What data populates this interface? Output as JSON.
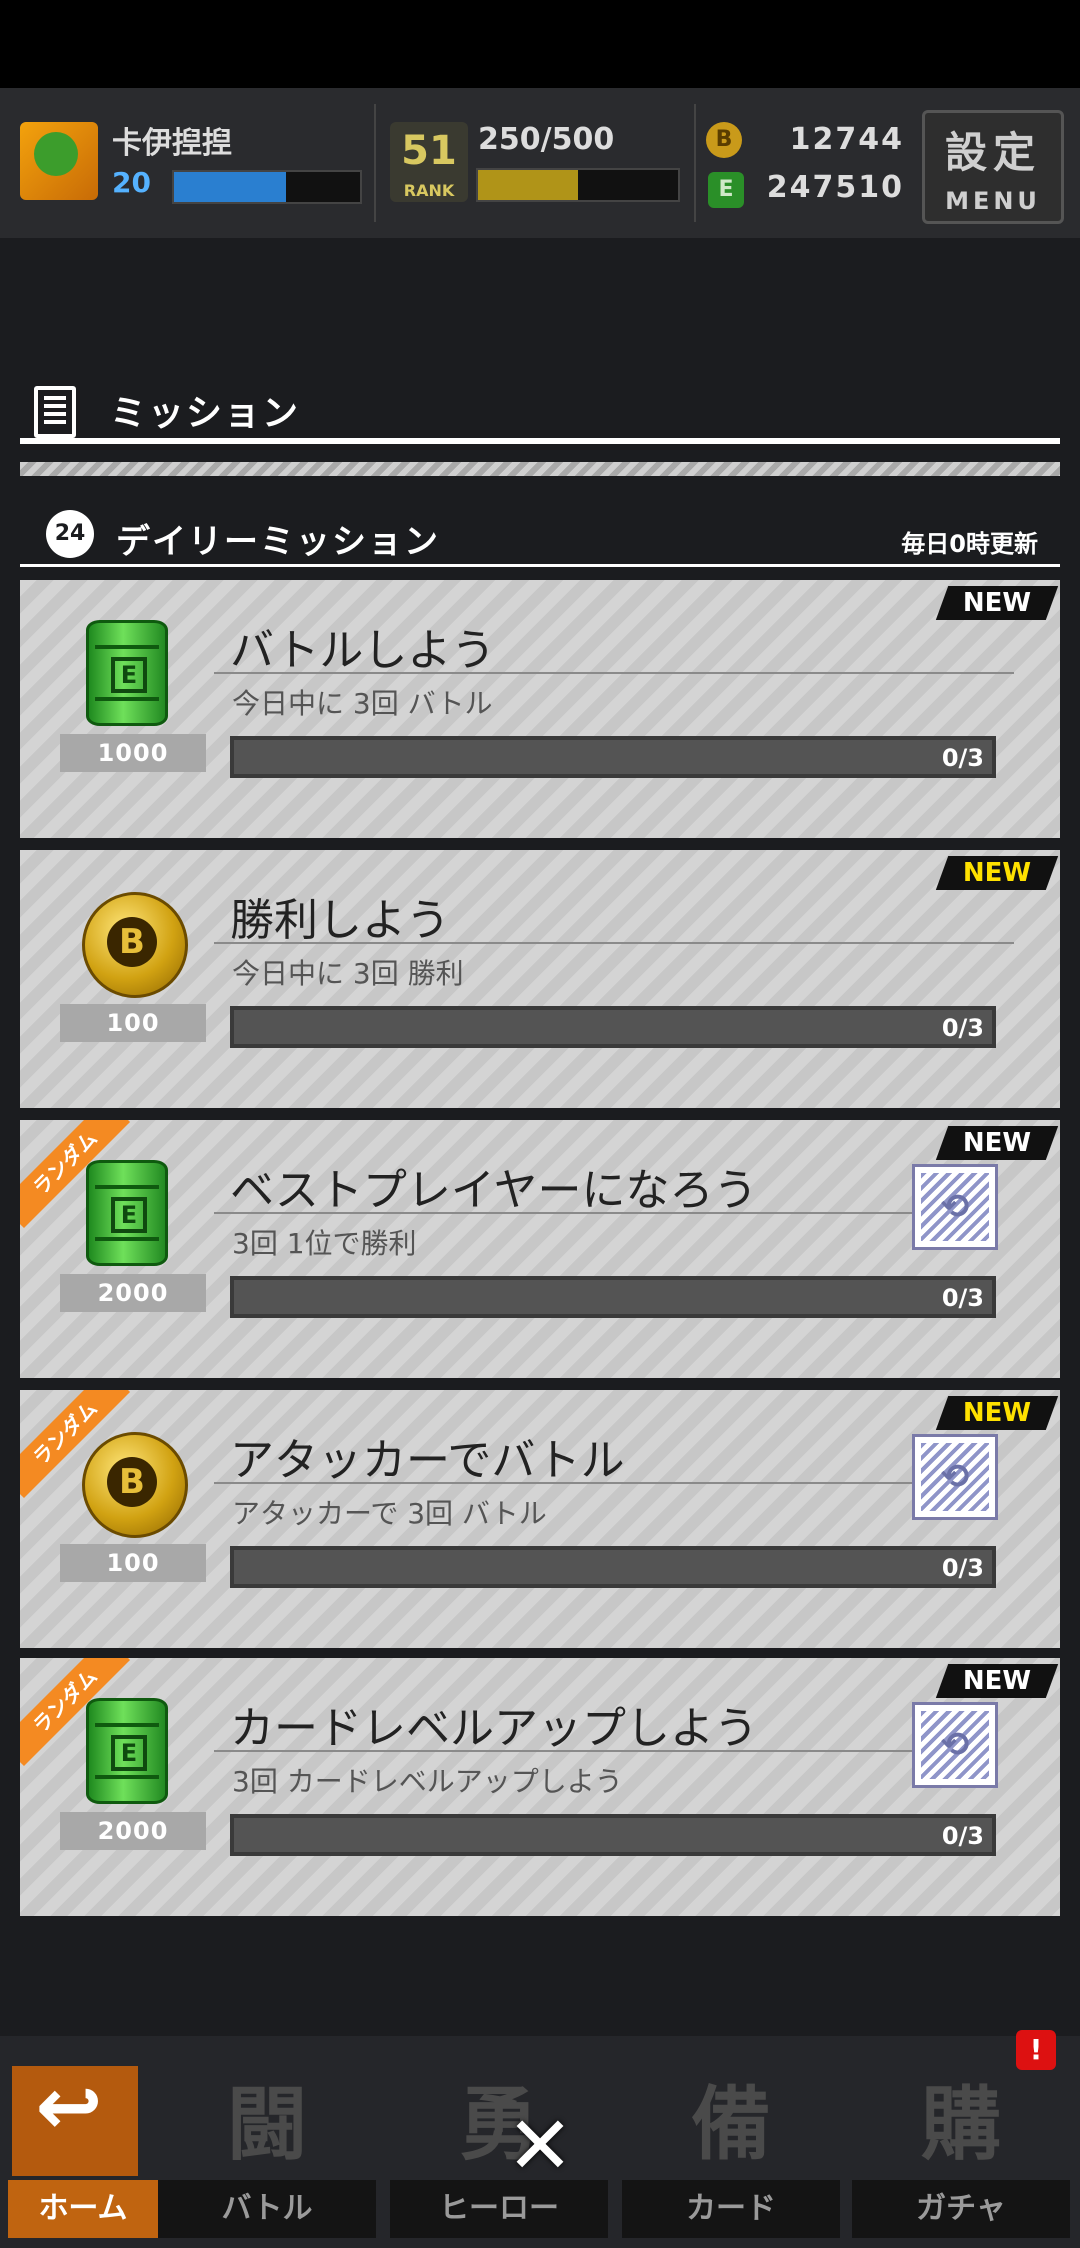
{
  "player": {
    "name": "卡伊揑揑",
    "level": "20",
    "level_fill": 0.6,
    "rank_badge": "51",
    "rank_label": "RANK",
    "rank_progress": "250/500",
    "rank_fill": 0.5
  },
  "currency": {
    "coin_icon": "B",
    "coin": "12744",
    "can_icon": "E",
    "can": "247510"
  },
  "menu_button": {
    "kanji": "設定",
    "label": "MENU"
  },
  "mission_panel": {
    "title": "ミッション",
    "daily_title": "デイリーミッション",
    "daily_icon_text": "24",
    "reset_note": "毎日0時更新"
  },
  "missions": [
    {
      "title": "バトルしよう",
      "subtitle": "今日中に 3回 バトル",
      "reward_icon": "b-can",
      "reward": "1000",
      "progress": "0/3",
      "badge": "NEW",
      "badge_color": "#ffffff",
      "random": false
    },
    {
      "title": "勝利しよう",
      "subtitle": "今日中に 3回 勝利",
      "reward_icon": "b-coin",
      "reward": "100",
      "progress": "0/3",
      "badge": "NEW",
      "badge_color": "#ffe100",
      "random": false
    },
    {
      "title": "ベストプレイヤーになろう",
      "subtitle": "3回 1位で勝利",
      "reward_icon": "b-can",
      "reward": "2000",
      "progress": "0/3",
      "badge": "NEW",
      "badge_color": "#ffffff",
      "random": true,
      "random_label": "ランダム"
    },
    {
      "title": "アタッカーでバトル",
      "subtitle": "アタッカーで 3回 バトル",
      "reward_icon": "b-coin",
      "reward": "100",
      "progress": "0/3",
      "badge": "NEW",
      "badge_color": "#ffe100",
      "random": true,
      "random_label": "ランダム"
    },
    {
      "title": "カードレベルアップしよう",
      "subtitle": "3回 カードレベルアップしよう",
      "reward_icon": "b-can",
      "reward": "2000",
      "progress": "0/3",
      "badge": "NEW",
      "badge_color": "#ffffff",
      "random": true,
      "random_label": "ランダム"
    }
  ],
  "nav": [
    {
      "glyph": "↩",
      "label": "ホーム"
    },
    {
      "glyph": "闘",
      "label": "バトル"
    },
    {
      "glyph": "勇",
      "label": "ヒーロー"
    },
    {
      "glyph": "備",
      "label": "カード"
    },
    {
      "glyph": "購",
      "label": "ガチャ"
    }
  ],
  "nav_alert": "!",
  "close_glyph": "✕",
  "reroll_glyph": "⟲"
}
